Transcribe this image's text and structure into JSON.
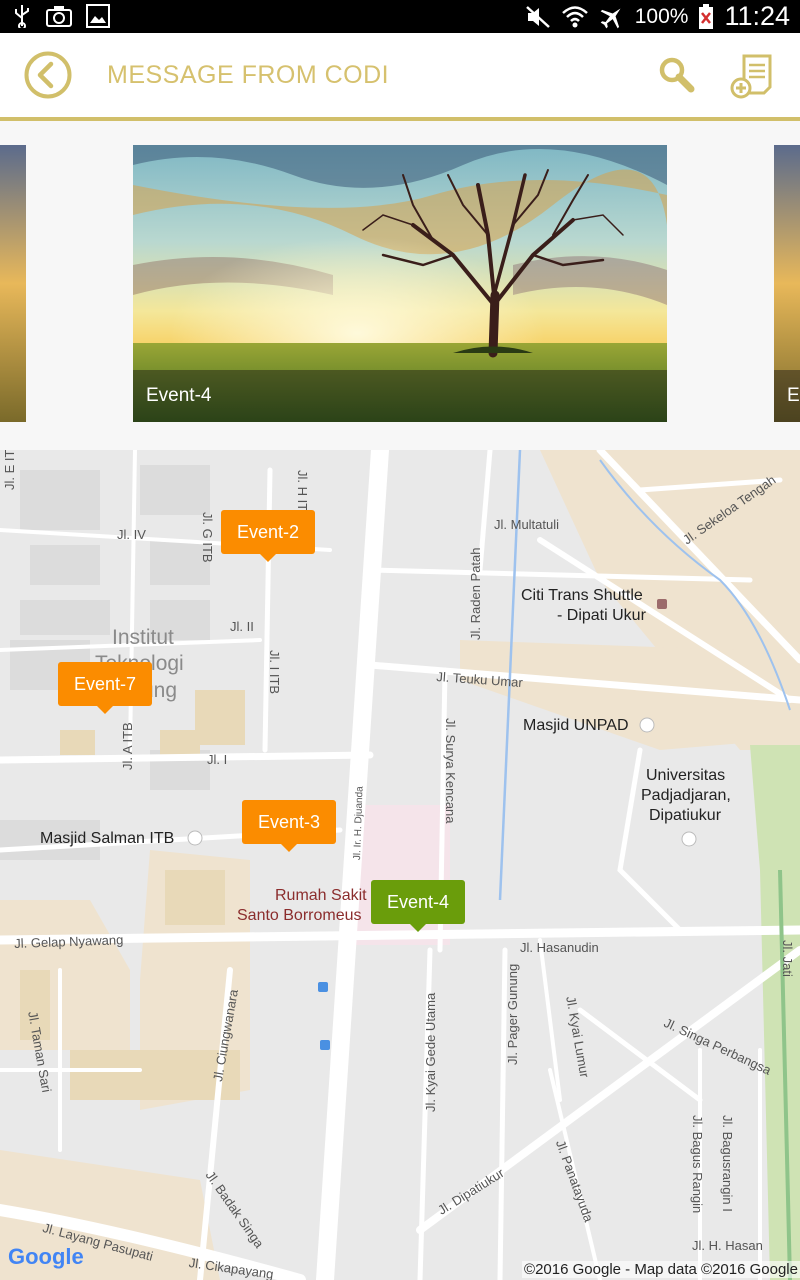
{
  "status_bar": {
    "battery": "100%",
    "time": "11:24",
    "icons": [
      "usb-icon",
      "camera-icon",
      "image-icon",
      "mute-icon",
      "wifi-icon",
      "airplane-icon",
      "battery-icon"
    ]
  },
  "app_bar": {
    "title": "MESSAGE FROM CODI",
    "accent_color": "#d1bf6a",
    "icons": [
      "back-icon",
      "search-icon",
      "add-note-icon"
    ]
  },
  "carousel": {
    "slides": [
      {
        "caption": ""
      },
      {
        "caption": "Event-4"
      },
      {
        "caption": "E"
      }
    ]
  },
  "map": {
    "markers": [
      {
        "label": "Event-2",
        "color": "#fb8c00"
      },
      {
        "label": "Event-7",
        "color": "#fb8c00"
      },
      {
        "label": "Event-3",
        "color": "#fb8c00"
      },
      {
        "label": "Event-4",
        "color": "#6a9d0b"
      }
    ],
    "places": {
      "citi_trans": "Citi Trans Shuttle",
      "citi_trans_2": "- Dipati Ukur",
      "masjid_unpad": "Masjid UNPAD",
      "univ_1": "Universitas",
      "univ_2": "Padjadjaran,",
      "univ_3": "Dipatiukur",
      "masjid_salman": "Masjid Salman ITB",
      "rs_1": "Rumah Sakit",
      "rs_2": "Santo Borromeus",
      "itb_1": "Institut",
      "itb_2": "Teknologi",
      "itb_3": "ung"
    },
    "streets": {
      "e_itb": "Jl. E ITB",
      "g_itb": "Jl. G ITB",
      "h_itb": "Jl. H ITB",
      "iv": "Jl. IV",
      "ii": "Jl. II",
      "i_itb": "Jl. I ITB",
      "i": "Jl. I",
      "a_itb": "Jl. A ITB",
      "multatuli": "Jl. Multatuli",
      "sekeloa": "Jl. Sekeloa Tengah",
      "raden_patah": "Jl. Raden Patah",
      "teuku_umar": "Jl. Teuku Umar",
      "surya_kencana": "Jl. Surya Kencana",
      "djuanda": "Jl. Ir. H. Djuanda",
      "gelap_nyawang": "Jl. Gelap Nyawang",
      "hasanudin": "Jl. Hasanudin",
      "taman_sari": "Jl. Taman Sari",
      "ciungwanara": "Jl. Ciungwanara",
      "kyai_gede": "Jl. Kyai Gede Utama",
      "pager_gunung": "Jl. Pager Gunung",
      "kyai_lumur": "Jl. Kyai Lumur",
      "singa_perbangsa": "Jl. Singa Perbangsa",
      "jl_jati": "Jl. Jati",
      "dipatiukur": "Jl. Dipatiukur",
      "panatayuda": "Jl. Panatayuda",
      "bagus_rangin": "Jl. Bagus Rangin",
      "bagusrangin_i": "Jl. Bagusrangin I",
      "badak_singa": "Jl. Badak Singa",
      "layang_pasupati": "Jl. Layang Pasupati",
      "cikapayang": "Jl. Cikapayang",
      "h_hasan": "Jl. H. Hasan"
    },
    "google_logo": "Google",
    "copyright": "©2016 Google - Map data ©2016 Google"
  }
}
